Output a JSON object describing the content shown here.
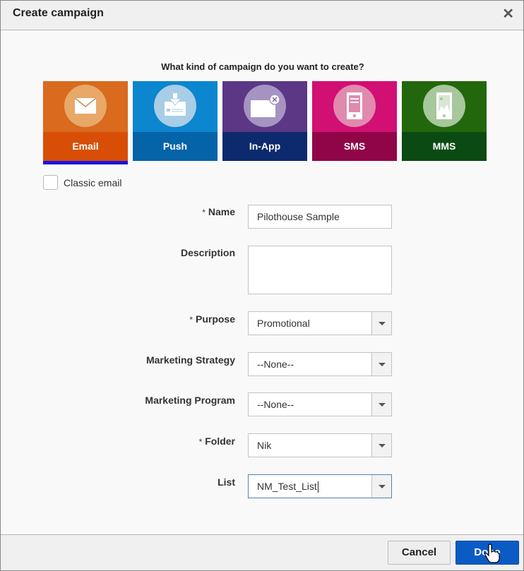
{
  "dialog": {
    "title": "Create campaign",
    "close_icon": "close-icon"
  },
  "question": "What kind of campaign do you want to create?",
  "campaign_types": [
    {
      "label": "Email",
      "icon": "envelope-icon",
      "top_color": "#d96a1e",
      "bottom_color": "#d84e06",
      "circle_color": "#e8a868",
      "selected": true
    },
    {
      "label": "Push",
      "icon": "push-download-icon",
      "top_color": "#0b86cf",
      "bottom_color": "#0563a8",
      "circle_color": "#a8cde6",
      "selected": false
    },
    {
      "label": "In-App",
      "icon": "in-app-window-icon",
      "top_color": "#5b3785",
      "bottom_color": "#0d2a6e",
      "circle_color": "#a594c2",
      "selected": false
    },
    {
      "label": "SMS",
      "icon": "mobile-text-icon",
      "top_color": "#d20f73",
      "bottom_color": "#900547",
      "circle_color": "#e08aae",
      "selected": false
    },
    {
      "label": "MMS",
      "icon": "mobile-image-icon",
      "top_color": "#23670c",
      "bottom_color": "#0b4a12",
      "circle_color": "#a7c79c",
      "selected": false
    }
  ],
  "classic_email": {
    "label": "Classic email",
    "checked": false
  },
  "form": {
    "required_marker": "*",
    "name": {
      "label": "Name",
      "value": "Pilothouse Sample",
      "required": true
    },
    "description": {
      "label": "Description",
      "value": ""
    },
    "purpose": {
      "label": "Purpose",
      "value": "Promotional",
      "required": true
    },
    "marketing_strategy": {
      "label": "Marketing Strategy",
      "value": "--None--"
    },
    "marketing_program": {
      "label": "Marketing Program",
      "value": "--None--"
    },
    "folder": {
      "label": "Folder",
      "value": "Nik",
      "required": true
    },
    "list": {
      "label": "List",
      "value": "NM_Test_List"
    }
  },
  "footer": {
    "cancel_label": "Cancel",
    "done_label": "Done"
  },
  "colors": {
    "primary_button": "#0a5bc4",
    "selected_indicator": "#1a10e0"
  }
}
